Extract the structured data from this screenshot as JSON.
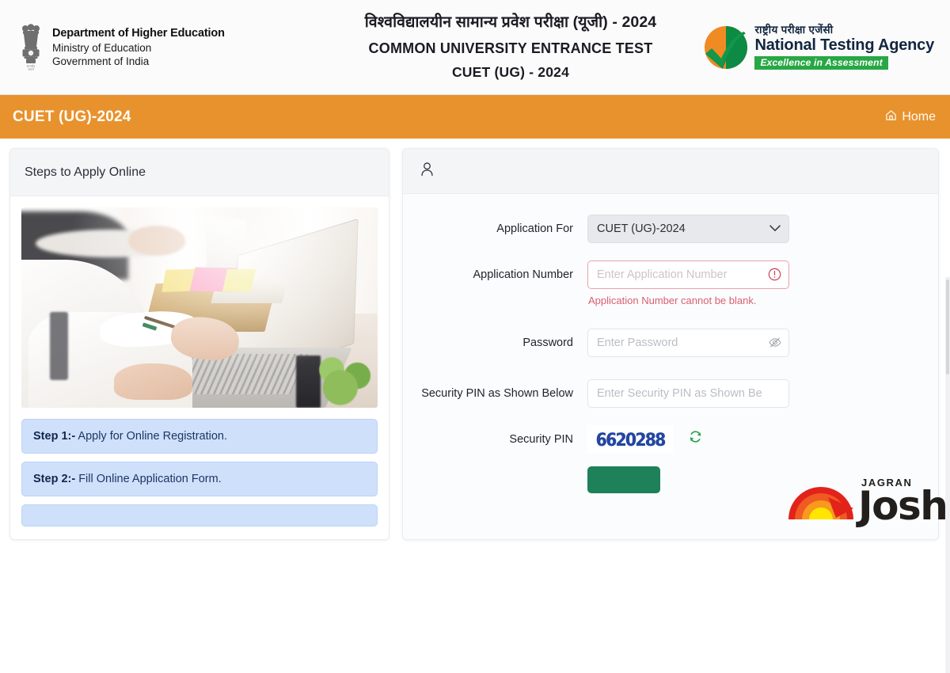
{
  "header": {
    "emblem_icon": "india-state-emblem-icon",
    "dept_line1": "Department of Higher Education",
    "dept_line2": "Ministry of Education",
    "dept_line3": "Government of India",
    "title_hindi": "विश्वविद्यालयीन सामान्य प्रवेश परीक्षा (यूजी) - 2024",
    "title_english": "COMMON UNIVERSITY ENTRANCE TEST",
    "title_sub": "CUET (UG) - 2024",
    "nta_logo_icon": "nta-tick-logo-icon",
    "nta_hindi": "राष्ट्रीय परीक्षा एजेंसी",
    "nta_english": "National Testing Agency",
    "nta_tagline": "Excellence in Assessment",
    "nta_green": "#28a745"
  },
  "navbar": {
    "brand": "CUET (UG)-2024",
    "home_label": "Home",
    "home_icon": "home-icon",
    "background": "#e8922e"
  },
  "left_panel": {
    "title": "Steps to Apply Online",
    "photo_alt": "person-typing-on-laptop-photo",
    "steps": [
      {
        "prefix": "Step 1:-",
        "text": " Apply for Online Registration."
      },
      {
        "prefix": "Step 2:-",
        "text": " Fill Online Application Form."
      }
    ]
  },
  "right_panel": {
    "header_icon": "user-icon",
    "fields": {
      "application_for": {
        "label": "Application For",
        "value": "CUET (UG)-2024",
        "caret_icon": "chevron-down-icon"
      },
      "application_number": {
        "label": "Application Number",
        "placeholder": "Enter Application Number",
        "value": "",
        "error": "Application Number cannot be blank.",
        "error_icon": "exclamation-circle-icon",
        "error_color": "#d9606e"
      },
      "password": {
        "label": "Password",
        "placeholder": "Enter Password",
        "value": "",
        "toggle_icon": "eye-slash-icon"
      },
      "security_pin_input": {
        "label": "Security PIN as Shown Below",
        "placeholder": "Enter Security PIN as Shown Below",
        "value": ""
      },
      "security_pin_captcha": {
        "label": "Security PIN",
        "captcha_text": "6620288",
        "captcha_color": "#2346a0",
        "refresh_icon": "refresh-icon",
        "refresh_color": "#22a043"
      }
    },
    "submit_button": {
      "label": "",
      "color": "#1e8159"
    }
  },
  "watermark": {
    "brand_top": "JAGRAN",
    "brand_main": "Josh",
    "sun_icon": "jagran-josh-sun-icon"
  }
}
